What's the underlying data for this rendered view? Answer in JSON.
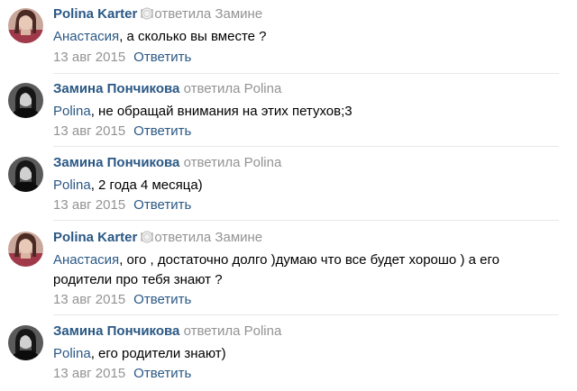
{
  "comments": [
    {
      "author": "Polina Karter",
      "has_emoji": true,
      "reply_verb": "ответила",
      "reply_to": "Замине",
      "mention": "Анастасия",
      "text": ", а сколько вы вместе ?",
      "date": "13 авг 2015",
      "reply_label": "Ответить",
      "avatar_icon": "avatar-female-photo"
    },
    {
      "author": "Замина Пончикова",
      "has_emoji": false,
      "reply_verb": "ответила",
      "reply_to": "Polina",
      "mention": "Polina",
      "text": ", не обращай внимания на этих петухов;3",
      "date": "13 авг 2015",
      "reply_label": "Ответить",
      "avatar_icon": "avatar-bw-photo"
    },
    {
      "author": "Замина Пончикова",
      "has_emoji": false,
      "reply_verb": "ответила",
      "reply_to": "Polina",
      "mention": "Polina",
      "text": ", 2 года 4 месяца)",
      "date": "13 авг 2015",
      "reply_label": "Ответить",
      "avatar_icon": "avatar-bw-photo"
    },
    {
      "author": "Polina Karter",
      "has_emoji": true,
      "reply_verb": "ответила",
      "reply_to": "Замине",
      "mention": "Анастасия",
      "text": ", ого , достаточно долго )думаю что все будет хорошо ) а его родители про тебя знают ?",
      "date": "13 авг 2015",
      "reply_label": "Ответить",
      "avatar_icon": "avatar-female-photo"
    },
    {
      "author": "Замина Пончикова",
      "has_emoji": false,
      "reply_verb": "ответила",
      "reply_to": "Polina",
      "mention": "Polina",
      "text": ", его родители знают)",
      "date": "13 авг 2015",
      "reply_label": "Ответить",
      "avatar_icon": "avatar-bw-photo"
    }
  ],
  "colors": {
    "link": "#2a5885",
    "meta": "#939393",
    "divider": "#e7e8ec"
  }
}
